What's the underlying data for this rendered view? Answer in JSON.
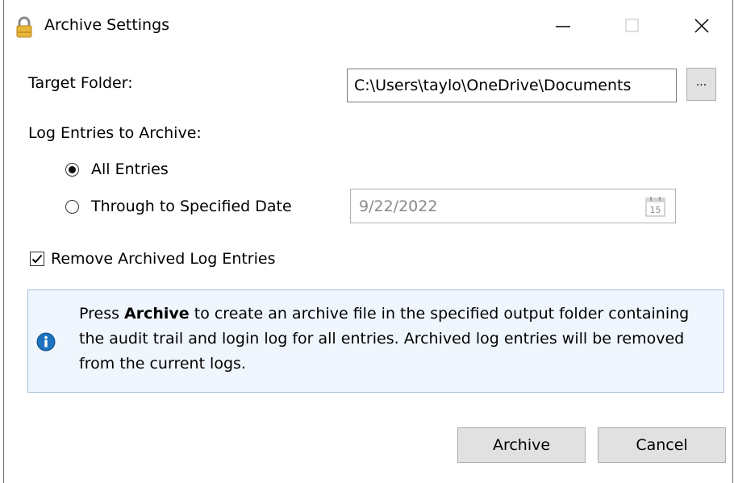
{
  "window": {
    "title": "Archive Settings"
  },
  "target_folder": {
    "label": "Target Folder:",
    "value": "C:\\Users\\taylo\\OneDrive\\Documents",
    "browse_label": "..."
  },
  "log_entries": {
    "label": "Log Entries to Archive:",
    "options": [
      {
        "label": "All Entries",
        "selected": true
      },
      {
        "label": "Through to Specified Date",
        "selected": false
      }
    ],
    "date_value": "9/22/2022",
    "calendar_day": "15"
  },
  "remove_archived": {
    "label": "Remove Archived Log Entries",
    "checked": true
  },
  "info": {
    "prefix": "Press ",
    "bold": "Archive",
    "rest": " to create an archive file in the specified output folder containing the audit trail and login log for all entries. Archived log entries will be removed from the current logs."
  },
  "buttons": {
    "archive": "Archive",
    "cancel": "Cancel"
  },
  "colors": {
    "info_background": "#f0f6fd",
    "info_border": "#a9c0d8",
    "info_icon": "#1e73be",
    "button_face": "#e1e1e1"
  },
  "icons": {
    "app": "padlock-icon",
    "info": "info-icon",
    "calendar": "calendar-icon"
  }
}
